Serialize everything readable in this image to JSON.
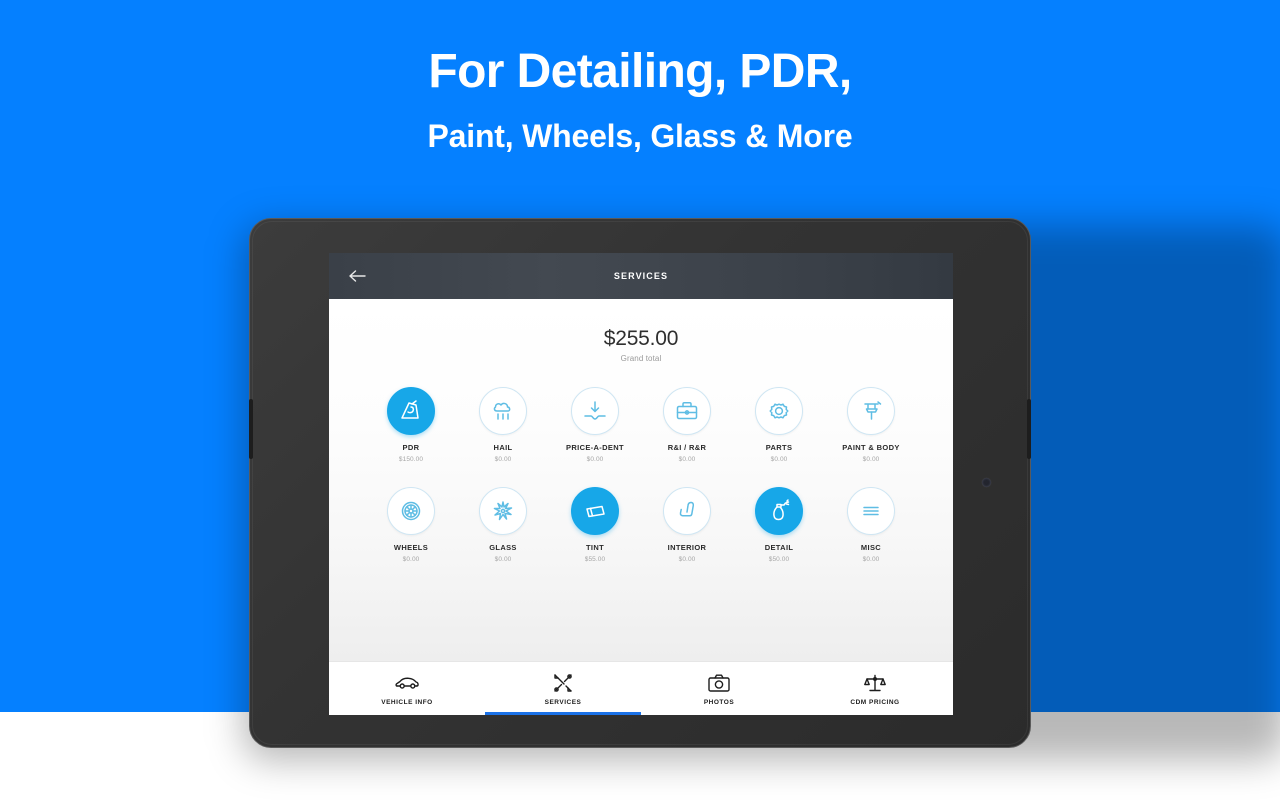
{
  "hero": {
    "headline": "For Detailing, PDR,",
    "subheadline": "Paint, Wheels, Glass & More",
    "background_color": "#0580ff",
    "text_color": "#ffffff"
  },
  "app": {
    "accent_color": "#17a7e8",
    "appbar": {
      "title": "SERVICES",
      "back_icon": "arrow-left-icon",
      "background_color": "#3c424a"
    },
    "summary": {
      "amount": "$255.00",
      "label": "Grand total"
    },
    "services_grid": {
      "rows": [
        [
          {
            "name": "PDR",
            "price": "$150.00",
            "icon": "dent-puller-icon",
            "active": true
          },
          {
            "name": "HAIL",
            "price": "$0.00",
            "icon": "hail-cloud-icon",
            "active": false
          },
          {
            "name": "PRICE-A-DENT",
            "price": "$0.00",
            "icon": "dent-arrow-icon",
            "active": false
          },
          {
            "name": "R&I / R&R",
            "price": "$0.00",
            "icon": "toolbox-icon",
            "active": false
          },
          {
            "name": "PARTS",
            "price": "$0.00",
            "icon": "gear-icon",
            "active": false
          },
          {
            "name": "PAINT & BODY",
            "price": "$0.00",
            "icon": "paint-gun-icon",
            "active": false
          }
        ],
        [
          {
            "name": "WHEELS",
            "price": "$0.00",
            "icon": "wheel-rim-icon",
            "active": false
          },
          {
            "name": "GLASS",
            "price": "$0.00",
            "icon": "glass-crack-icon",
            "active": false
          },
          {
            "name": "TINT",
            "price": "$55.00",
            "icon": "tint-film-icon",
            "active": true
          },
          {
            "name": "INTERIOR",
            "price": "$0.00",
            "icon": "car-seat-icon",
            "active": false
          },
          {
            "name": "DETAIL",
            "price": "$50.00",
            "icon": "spray-bottle-icon",
            "active": true
          },
          {
            "name": "MISC",
            "price": "$0.00",
            "icon": "list-lines-icon",
            "active": false
          }
        ]
      ]
    },
    "tabbar": {
      "active_index": 1,
      "active_color": "#1b72e8",
      "tabs": [
        {
          "label": "VEHICLE INFO",
          "icon": "car-icon"
        },
        {
          "label": "SERVICES",
          "icon": "tools-icon"
        },
        {
          "label": "PHOTOS",
          "icon": "camera-icon"
        },
        {
          "label": "CDM PRICING",
          "icon": "scales-icon"
        }
      ]
    },
    "navbar": {
      "back": "android-back-icon",
      "home": "android-home-icon",
      "recents": "android-recents-icon"
    }
  }
}
